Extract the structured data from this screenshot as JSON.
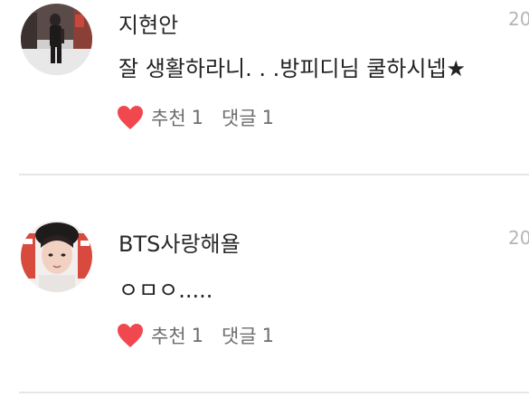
{
  "comments": [
    {
      "author": "지현안",
      "date": "20",
      "text": "잘 생활하라니. . .방피디님 쿨하시넵★",
      "like_label": "추천",
      "like_count": "1",
      "reply_label": "댓글",
      "reply_count": "1",
      "avatar_icon": "user-photo-street"
    },
    {
      "author": "BTS사랑해욜",
      "date": "20",
      "text": "ㅇㅁㅇ.....",
      "like_label": "추천",
      "like_count": "1",
      "reply_label": "댓글",
      "reply_count": "1",
      "avatar_icon": "user-photo-portrait"
    }
  ],
  "colors": {
    "heart": "#f0484e",
    "divider": "#e6e6e6",
    "meta_text": "#6d6d6d",
    "date_text": "#b5b5b5"
  }
}
